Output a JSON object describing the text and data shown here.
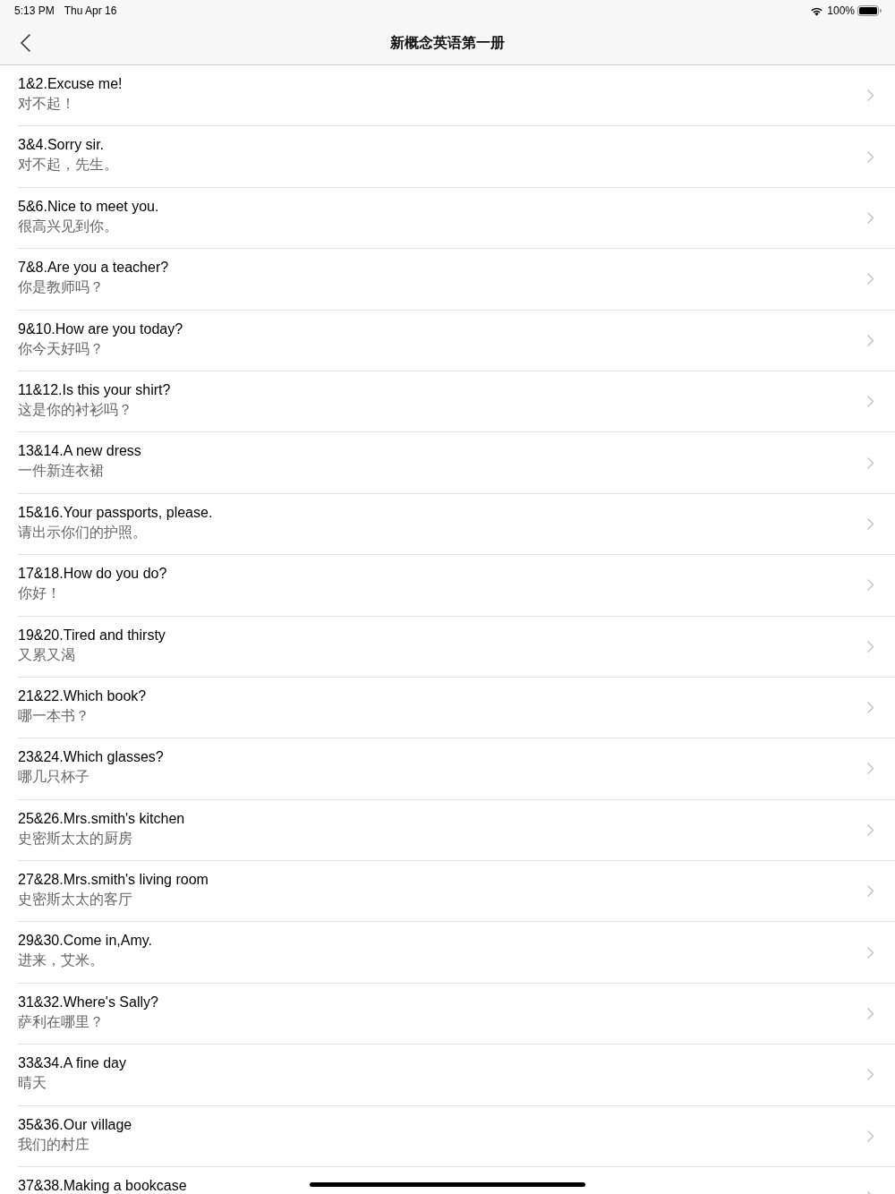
{
  "status_bar": {
    "time": "5:13 PM",
    "date": "Thu Apr 16",
    "battery": "100%"
  },
  "nav_bar": {
    "title": "新概念英语第一册"
  },
  "lessons": [
    {
      "title": "1&2.Excuse me!",
      "subtitle": "对不起！"
    },
    {
      "title": "3&4.Sorry sir.",
      "subtitle": "对不起，先生。"
    },
    {
      "title": "5&6.Nice to meet you.",
      "subtitle": "很高兴见到你。"
    },
    {
      "title": "7&8.Are you a teacher?",
      "subtitle": "你是教师吗？"
    },
    {
      "title": "9&10.How are you today?",
      "subtitle": "你今天好吗？"
    },
    {
      "title": "11&12.Is this your shirt?",
      "subtitle": "这是你的衬衫吗？"
    },
    {
      "title": "13&14.A new dress",
      "subtitle": "一件新连衣裙"
    },
    {
      "title": "15&16.Your passports, please.",
      "subtitle": "请出示你们的护照。"
    },
    {
      "title": "17&18.How do you do?",
      "subtitle": "你好！"
    },
    {
      "title": "19&20.Tired and thirsty",
      "subtitle": "又累又渴"
    },
    {
      "title": "21&22.Which book?",
      "subtitle": "哪一本书？"
    },
    {
      "title": "23&24.Which glasses?",
      "subtitle": "哪几只杯子"
    },
    {
      "title": "25&26.Mrs.smith's kitchen",
      "subtitle": "史密斯太太的厨房"
    },
    {
      "title": "27&28.Mrs.smith's living room",
      "subtitle": "史密斯太太的客厅"
    },
    {
      "title": "29&30.Come in,Amy.",
      "subtitle": "进来，艾米。"
    },
    {
      "title": "31&32.Where's Sally?",
      "subtitle": "萨利在哪里？"
    },
    {
      "title": "33&34.A fine day",
      "subtitle": "晴天"
    },
    {
      "title": "35&36.Our village",
      "subtitle": "我们的村庄"
    },
    {
      "title": "37&38.Making a bookcase"
    }
  ]
}
